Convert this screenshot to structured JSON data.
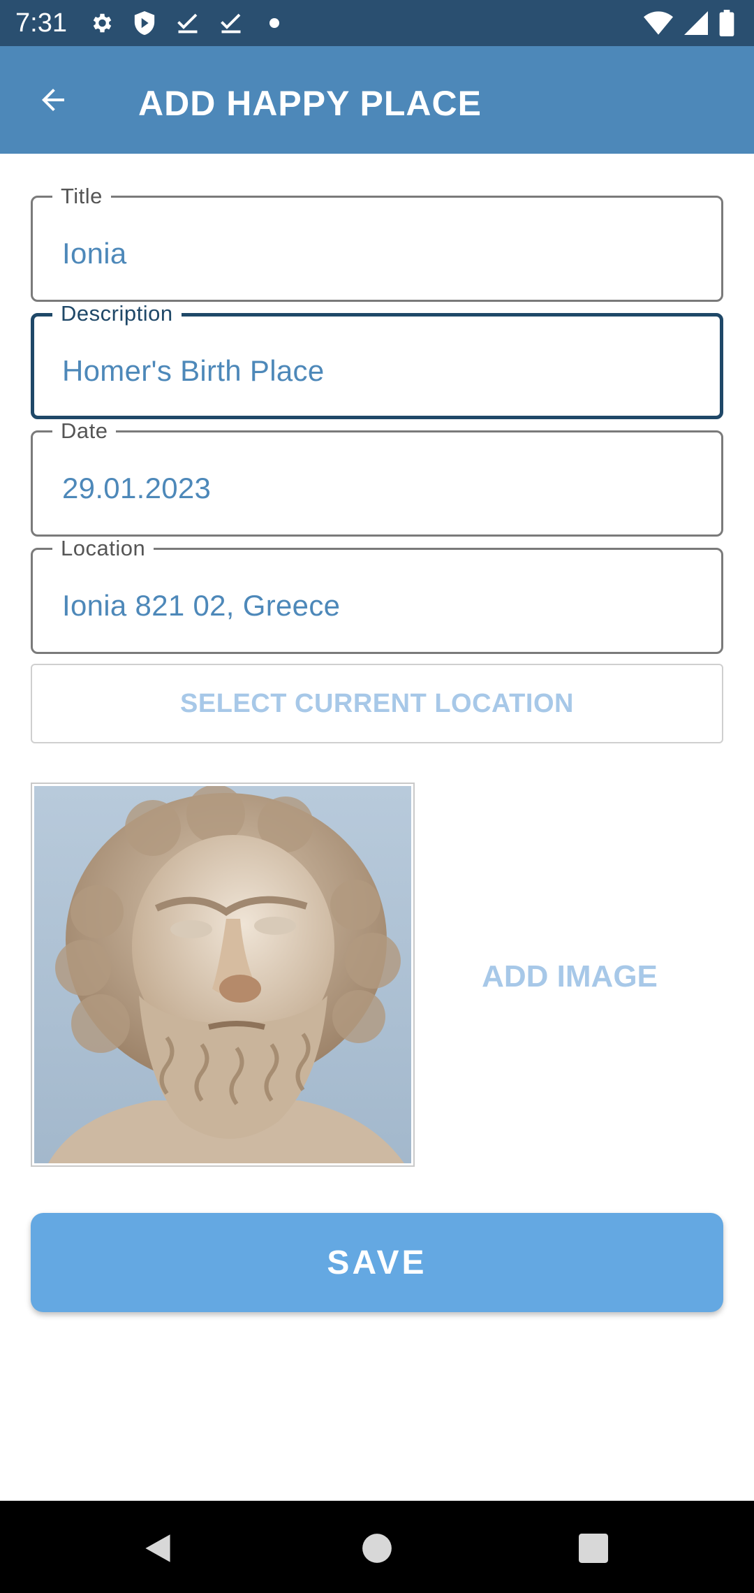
{
  "status_bar": {
    "time": "7:31",
    "icons_left": [
      "settings-icon",
      "shield-icon",
      "checkmark-icon",
      "checkmark-icon",
      "dot-icon"
    ],
    "icons_right": [
      "wifi-icon",
      "signal-icon",
      "battery-icon"
    ]
  },
  "app_bar": {
    "title": "ADD HAPPY PLACE",
    "back_icon": "arrow-left-icon",
    "color": "#4d88b9"
  },
  "form": {
    "title": {
      "label": "Title",
      "value": "Ionia"
    },
    "description": {
      "label": "Description",
      "value": "Homer's Birth Place"
    },
    "date": {
      "label": "Date",
      "value": "29.01.2023"
    },
    "location": {
      "label": "Location",
      "value": "Ionia 821 02, Greece"
    }
  },
  "select_location_label": "SELECT CURRENT LOCATION",
  "add_image_label": "ADD IMAGE",
  "save_label": "SAVE",
  "colors": {
    "accent": "#64a8e2",
    "field_text": "#4d88b9",
    "focused_border": "#1f4868",
    "status_bar": "#2a4f70"
  },
  "nav_bar": {
    "icons": [
      "back-triangle-icon",
      "home-circle-icon",
      "recents-square-icon"
    ]
  }
}
